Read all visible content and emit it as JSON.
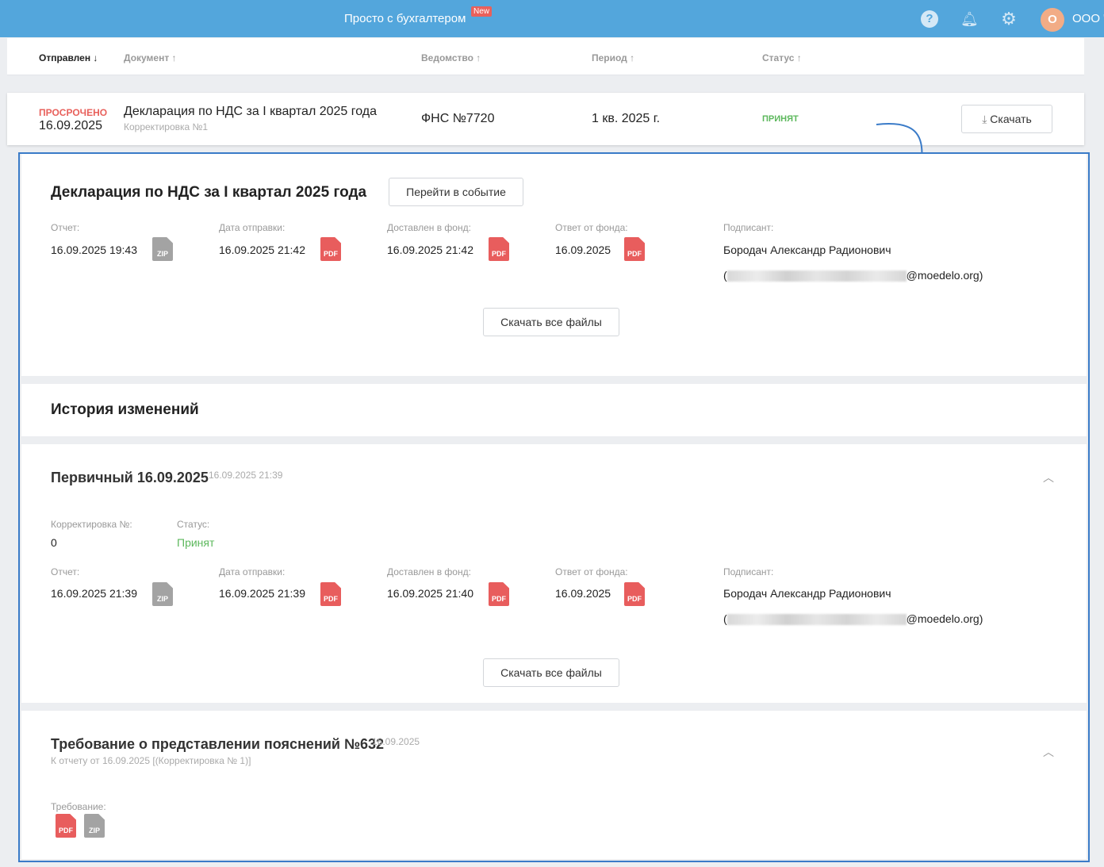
{
  "header": {
    "brand": "Просто с бухгалтером",
    "new_badge": "New",
    "avatar_letter": "О",
    "org": "ООО \""
  },
  "table": {
    "columns": [
      "Отправлен ↓",
      "Документ ↑",
      "Ведомство ↑",
      "Период ↑",
      "Статус ↑"
    ],
    "row": {
      "overdue": "ПРОСРОЧЕНО",
      "date": "16.09.2025",
      "doc": "Декларация по НДС за I квартал 2025 года",
      "sub": "Корректировка №1",
      "agency": "ФНС №7720",
      "period": "1 кв. 2025 г.",
      "status": "ПРИНЯТ",
      "download": "Скачать"
    }
  },
  "detail": {
    "title": "Декларация по НДС за I квартал 2025 года",
    "goto_event": "Перейти в событие",
    "fields": [
      {
        "label": "Отчет:",
        "value": "16.09.2025 19:43",
        "file": "ZIP"
      },
      {
        "label": "Дата отправки:",
        "value": "16.09.2025 21:42",
        "file": "PDF"
      },
      {
        "label": "Доставлен в фонд:",
        "value": "16.09.2025 21:42",
        "file": "PDF"
      },
      {
        "label": "Ответ от фонда:",
        "value": "16.09.2025",
        "file": "PDF"
      }
    ],
    "signer_label": "Подписант:",
    "signer": "Бородач Александр Радионович",
    "email_suffix": "@moedelo.org)",
    "email_prefix": "(",
    "download_all": "Скачать все файлы"
  },
  "history": {
    "title": "История изменений",
    "primary": {
      "title": "Первичный 16.09.2025",
      "time": "16.09.2025 21:39",
      "corr_label": "Корректировка №:",
      "corr_value": "0",
      "status_label": "Статус:",
      "status_value": "Принят",
      "fields": [
        {
          "label": "Отчет:",
          "value": "16.09.2025 21:39",
          "file": "ZIP"
        },
        {
          "label": "Дата отправки:",
          "value": "16.09.2025 21:39",
          "file": "PDF"
        },
        {
          "label": "Доставлен в фонд:",
          "value": "16.09.2025 21:40",
          "file": "PDF"
        },
        {
          "label": "Ответ от фонда:",
          "value": "16.09.2025",
          "file": "PDF"
        }
      ],
      "signer_label": "Подписант:",
      "signer": "Бородач Александр Радионович",
      "email_prefix": "(",
      "email_suffix": "@moedelo.org)",
      "download_all": "Скачать все файлы"
    },
    "requirement": {
      "title": "Требование о представлении пояснений №632",
      "date": "16.09.2025",
      "sub": "К отчету от 16.09.2025 [(Корректировка № 1)]",
      "label": "Требование:",
      "files": [
        "PDF",
        "ZIP"
      ]
    }
  },
  "colors": {
    "header": "#53a6dc",
    "overdue": "#e8605b",
    "accepted": "#5cb85c",
    "panel_border": "#3a7bc8"
  }
}
